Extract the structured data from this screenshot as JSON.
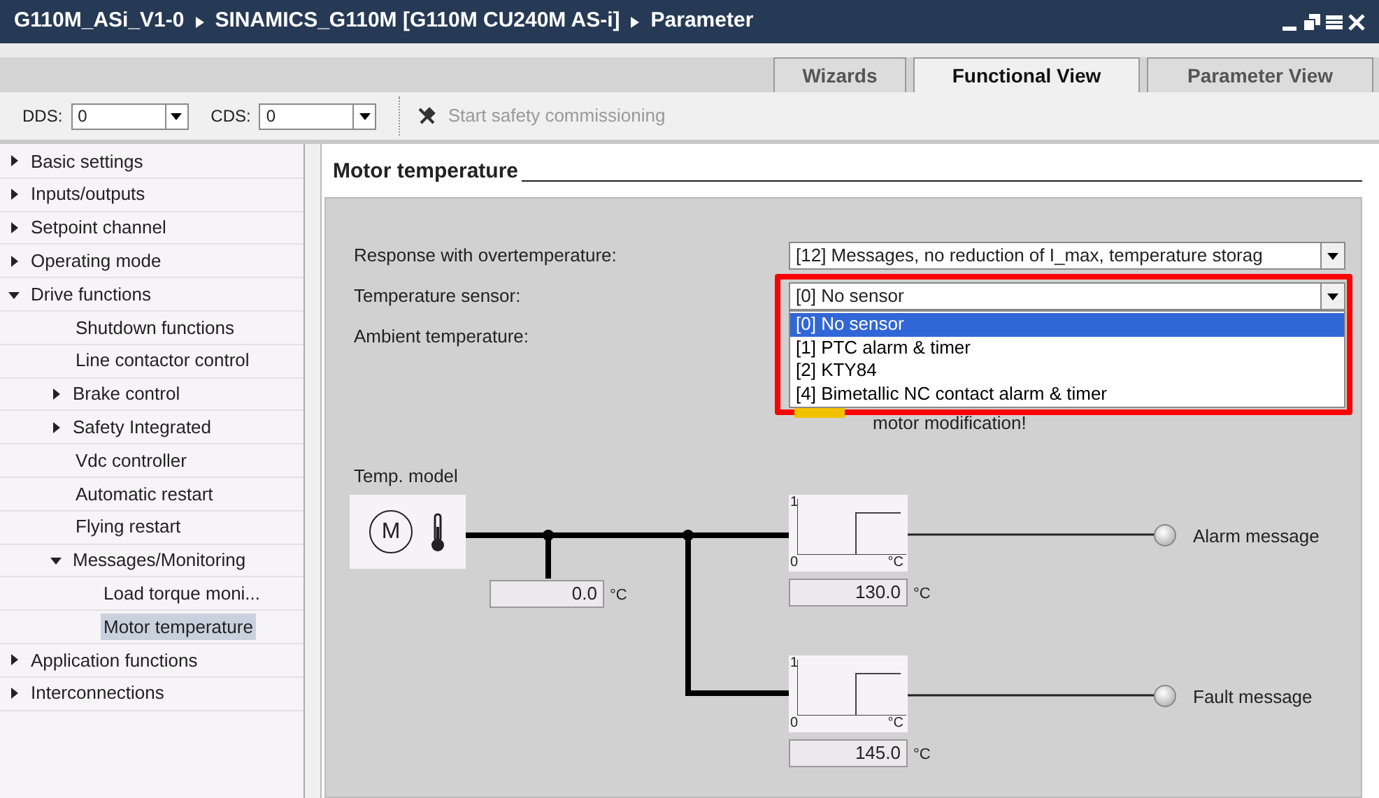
{
  "title_bar": {
    "breadcrumb": [
      "G110M_ASi_V1-0",
      "SINAMICS_G110M [G110M CU240M AS-i]",
      "Parameter"
    ]
  },
  "tabs": [
    {
      "label": "Wizards",
      "selected": false
    },
    {
      "label": "Functional View",
      "selected": true
    },
    {
      "label": "Parameter View",
      "selected": false
    }
  ],
  "toolbar": {
    "fields": [
      {
        "label": "DDS:",
        "value": "0"
      },
      {
        "label": "CDS:",
        "value": "0"
      }
    ],
    "action": {
      "label": "Start safety commissioning",
      "disabled": true
    }
  },
  "navigation": [
    {
      "label": "Basic settings",
      "expanded": false,
      "selected": false
    },
    {
      "label": "Inputs/outputs",
      "expanded": false,
      "selected": false
    },
    {
      "label": "Setpoint channel",
      "expanded": false,
      "selected": false
    },
    {
      "label": "Operating mode",
      "expanded": false,
      "selected": false
    },
    {
      "label": "Drive functions",
      "expanded": true,
      "selected": false,
      "children": [
        {
          "label": "Shutdown functions",
          "selected": false
        },
        {
          "label": "Line contactor control",
          "selected": false
        },
        {
          "label": "Brake control",
          "expanded": false,
          "selected": false
        },
        {
          "label": "Safety Integrated",
          "expanded": false,
          "selected": false
        },
        {
          "label": "Vdc controller",
          "selected": false
        },
        {
          "label": "Automatic restart",
          "selected": false
        },
        {
          "label": "Flying restart",
          "selected": false
        },
        {
          "label": "Messages/Monitoring",
          "expanded": true,
          "selected": false,
          "children": [
            {
              "label": "Load torque moni...",
              "selected": false
            },
            {
              "label": "Motor temperature",
              "selected": true
            }
          ]
        }
      ]
    },
    {
      "label": "Application functions",
      "expanded": false,
      "selected": false
    },
    {
      "label": "Interconnections",
      "expanded": false,
      "selected": false
    }
  ],
  "section": {
    "title": "Motor temperature"
  },
  "settings": [
    {
      "kind": "dropdown",
      "label": "Response with overtemperature:",
      "value": "[12] Messages, no reduction of I_max, temperature storag"
    },
    {
      "kind": "dropdown",
      "label": "Temperature sensor:",
      "value": "[0] No sensor",
      "expanded": true,
      "highlighted": true,
      "options": [
        {
          "label": "[0] No sensor",
          "selected": true
        },
        {
          "label": "[1] PTC alarm & timer",
          "selected": false
        },
        {
          "label": "[2] KTY84",
          "selected": false
        },
        {
          "label": "[4] Bimetallic NC contact alarm & timer",
          "selected": false
        }
      ]
    },
    {
      "kind": "label",
      "label": "Ambient temperature:"
    }
  ],
  "warning": {
    "text": "motor modification!"
  },
  "temp_model": {
    "title": "Temp. model",
    "motor_symbol": "M",
    "model_value": {
      "value": "0.0",
      "unit": "°C"
    },
    "thresholds": [
      {
        "axis_high": "1",
        "axis_low": "0",
        "axis_unit": "°C",
        "value": "130.0",
        "unit": "°C",
        "message": "Alarm message"
      },
      {
        "axis_high": "1",
        "axis_low": "0",
        "axis_unit": "°C",
        "value": "145.0",
        "unit": "°C",
        "message": "Fault message"
      }
    ]
  }
}
